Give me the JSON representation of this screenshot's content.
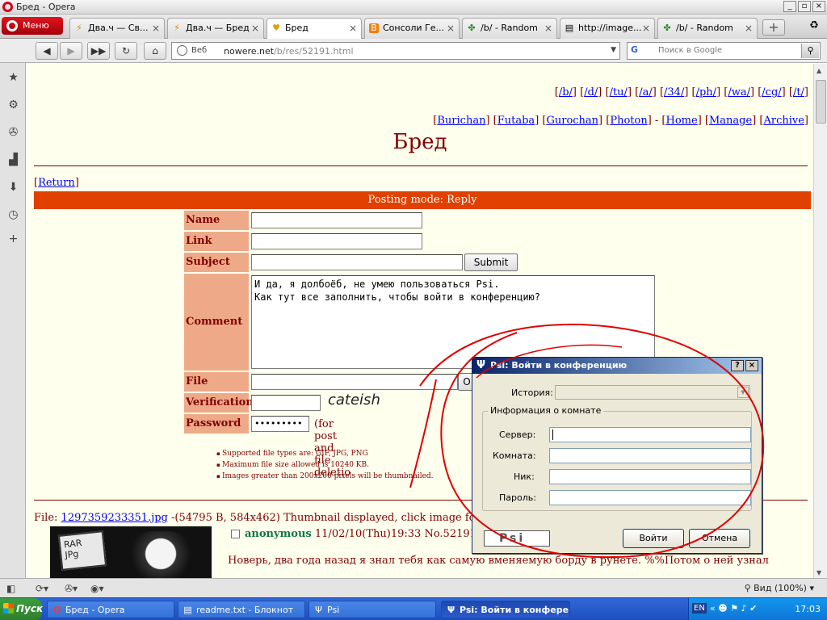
{
  "window": {
    "title": "Бред - Opera",
    "buttons": [
      "_",
      "▫",
      "×"
    ]
  },
  "menu": {
    "label": "Меню"
  },
  "tabs": [
    {
      "label": "Два.ч — Св...",
      "icon": "⚡"
    },
    {
      "label": "Два.ч — Бред",
      "icon": "⚡"
    },
    {
      "label": "Бред",
      "icon": "♥",
      "active": true
    },
    {
      "label": "Сонсоли Ге...",
      "icon": "B"
    },
    {
      "label": "/b/ - Random",
      "icon": "✤"
    },
    {
      "label": "http://image...",
      "icon": "▤"
    },
    {
      "label": "/b/ - Random",
      "icon": "✤"
    }
  ],
  "newtab": "+",
  "address": {
    "prefix_label": "Веб",
    "domain": "nowere.net",
    "path": "/b/res/52191.html"
  },
  "search": {
    "placeholder": "Поиск в Google",
    "engine": "G"
  },
  "board_nav": [
    "/b/",
    "/d/",
    "/tu/",
    "/a/",
    "/34/",
    "/ph/",
    "/wa/",
    "/cg/",
    "/t/"
  ],
  "style_nav": [
    "Burichan",
    "Futaba",
    "Gurochan",
    "Photon"
  ],
  "site_nav": [
    "Home",
    "Manage",
    "Archive"
  ],
  "logo": "Бред",
  "return_label": "Return",
  "postmode": "Posting mode: Reply",
  "form": {
    "name_label": "Name",
    "link_label": "Link",
    "subject_label": "Subject",
    "submit_label": "Submit",
    "comment_label": "Comment",
    "comment_value": "И да, я долбоёб, не умею пользоваться Psi.\nКак тут все заполнить, чтобы войти в конференцию?",
    "file_label": "File",
    "verification_label": "Verification",
    "captcha_text": "cateish",
    "password_label": "Password",
    "password_value": "•••••••••",
    "delete_note": "(for post and file deletio",
    "file_button_partial": "O"
  },
  "rules": [
    "Supported file types are: GIF, JPG, PNG",
    "Maximum file size allowed is 10240 KB.",
    "Images greater than 200x200 pixels will be thumbnailed."
  ],
  "post": {
    "file_prefix": "File: ",
    "file_name": "1297359233351.jpg",
    "file_meta": " -(54795 B, 584x462) Thumbnail displayed, click image for full size.",
    "thumb_text": "RAR\nJPg",
    "name": "anonymous",
    "date": "11/02/10(Thu)19:33",
    "number": "No.52191",
    "text": "Новерь, два года назад я знал тебя как самую вменяемую борду в рунете. %%Потом о ней узнал"
  },
  "dialog": {
    "title": "Psi: Войти в конференцию",
    "history_label": "История:",
    "group_label": "Информация о комнате",
    "fields": [
      "Сервер:",
      "Комната:",
      "Ник:",
      "Пароль:"
    ],
    "logo_text": "Psi",
    "join_label": "Войти",
    "cancel_label": "Отмена",
    "help_btn": "?",
    "close_btn": "×"
  },
  "statusbar": {
    "zoom": "Вид (100%)"
  },
  "taskbar": {
    "start_label": "Пуск",
    "buttons": [
      {
        "label": "Бред - Opera",
        "icon": "O"
      },
      {
        "label": "readme.txt - Блокнот",
        "icon": "▤"
      },
      {
        "label": "Psi",
        "icon": "Ψ"
      },
      {
        "label": "Psi: Войти в конфере...",
        "icon": "Ψ",
        "active": true
      }
    ],
    "lang": "EN",
    "tray_icons": "« ☻ ⚑ ♪ ✔",
    "clock": "17:03"
  },
  "colors": {
    "page_bg": "#ffffee",
    "board_text": "#800000",
    "postmode_bg": "#e04000",
    "label_bg": "#eeaa88",
    "scribble": "#e00000"
  }
}
